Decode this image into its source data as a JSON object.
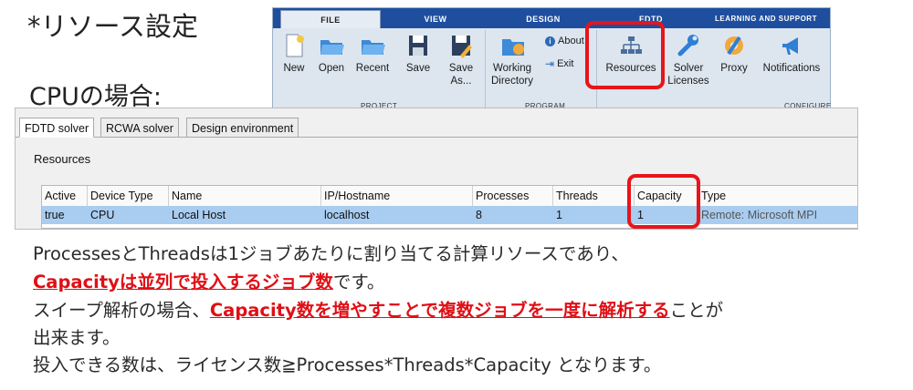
{
  "slide": {
    "title": "*リソース設定",
    "subtitle": "CPUの場合:"
  },
  "ribbon": {
    "tabs": [
      "File",
      "View",
      "Design",
      "FDTD",
      "Learning and Support"
    ],
    "buttons": {
      "new": "New",
      "open": "Open",
      "recent": "Recent",
      "save": "Save",
      "save_as": "Save As...",
      "working_directory": "Working Directory",
      "about": "About",
      "exit": "Exit",
      "resources": "Resources",
      "solver_licenses": "Solver Licenses",
      "proxy": "Proxy",
      "notifications": "Notifications"
    },
    "groups": {
      "project": "Project",
      "program": "Program",
      "configure": "Configure"
    },
    "colors": {
      "tab_bar": "#1f4e9e",
      "highlight": "#e8141b"
    }
  },
  "panel": {
    "tabs": [
      "FDTD solver",
      "RCWA solver",
      "Design environment"
    ],
    "section_label": "Resources",
    "columns": [
      "Active",
      "Device Type",
      "Name",
      "IP/Hostname",
      "Processes",
      "Threads",
      "Capacity",
      "Type"
    ],
    "rows": [
      [
        "true",
        "CPU",
        "Local Host",
        "localhost",
        "8",
        "1",
        "1",
        "Remote: Microsoft MPI"
      ]
    ]
  },
  "text": {
    "line1": "ProcessesとThreadsは1ジョブあたりに割り当てる計算リソースであり、",
    "line2_em": "Capacityは並列で投入するジョブ数",
    "line2_rest": "です。",
    "line3_pre": "スイープ解析の場合、",
    "line3_em": "Capacity数を増やすことで複数ジョブを一度に解析する",
    "line3_rest": "ことが",
    "line4": "出来ます。",
    "line5": "投入できる数は、ライセンス数≧Processes*Threads*Capacity となります。"
  }
}
